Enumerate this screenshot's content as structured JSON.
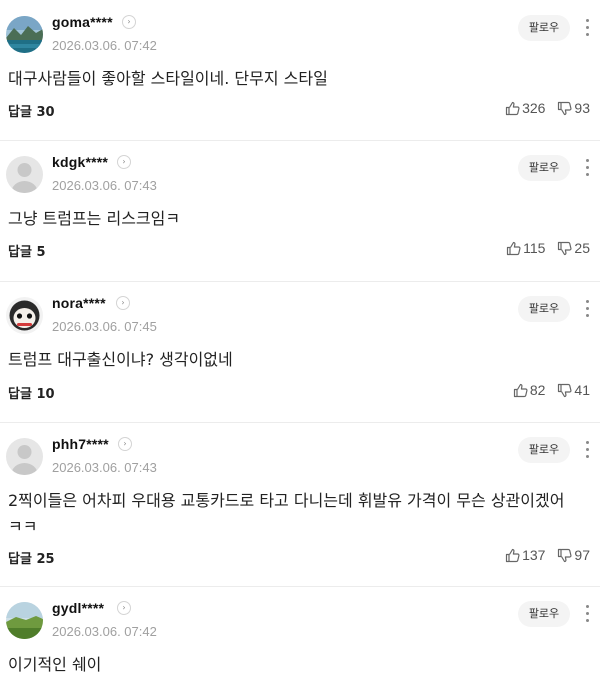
{
  "comments": [
    {
      "user": "goma****",
      "time": "2026.03.06. 07:42",
      "follow_label": "팔로우",
      "text": "대구사람들이 좋아할 스타일이네. 단무지 스타일",
      "reply": "답글 30",
      "likes": "326",
      "dislikes": "93",
      "avatar_icon": "lake-landscape-photo"
    },
    {
      "user": "kdgk****",
      "time": "2026.03.06. 07:43",
      "follow_label": "팔로우",
      "text": "그냥 트럼프는 리스크임ㅋ",
      "reply": "답글 5",
      "likes": "115",
      "dislikes": "25",
      "avatar_icon": "default-user-icon"
    },
    {
      "user": "nora****",
      "time": "2026.03.06. 07:45",
      "follow_label": "팔로우",
      "text": "트럼프 대구출신이냐? 생각이없네",
      "reply": "답글 10",
      "likes": "82",
      "dislikes": "41",
      "avatar_icon": "character-face-photo"
    },
    {
      "user": "phh7****",
      "time": "2026.03.06. 07:43",
      "follow_label": "팔로우",
      "text": "2찍이들은 어차피 우대용 교통카드로 타고 다니는데 휘발유 가격이 무슨 상관이겠어 ㅋㅋ",
      "reply": "답글 25",
      "likes": "137",
      "dislikes": "97",
      "avatar_icon": "default-user-icon"
    },
    {
      "user": "gydl****",
      "time": "2026.03.06. 07:42",
      "follow_label": "팔로우",
      "text": "이기적인 쉐이",
      "reply": "",
      "likes": "",
      "dislikes": "",
      "avatar_icon": "grass-field-photo"
    }
  ],
  "colors": {
    "name": "#111111",
    "timestamp": "#a0a0a0",
    "follow_bg": "#f4f4f4",
    "divider": "#ececec",
    "default_avatar": "#c8c8c8"
  }
}
